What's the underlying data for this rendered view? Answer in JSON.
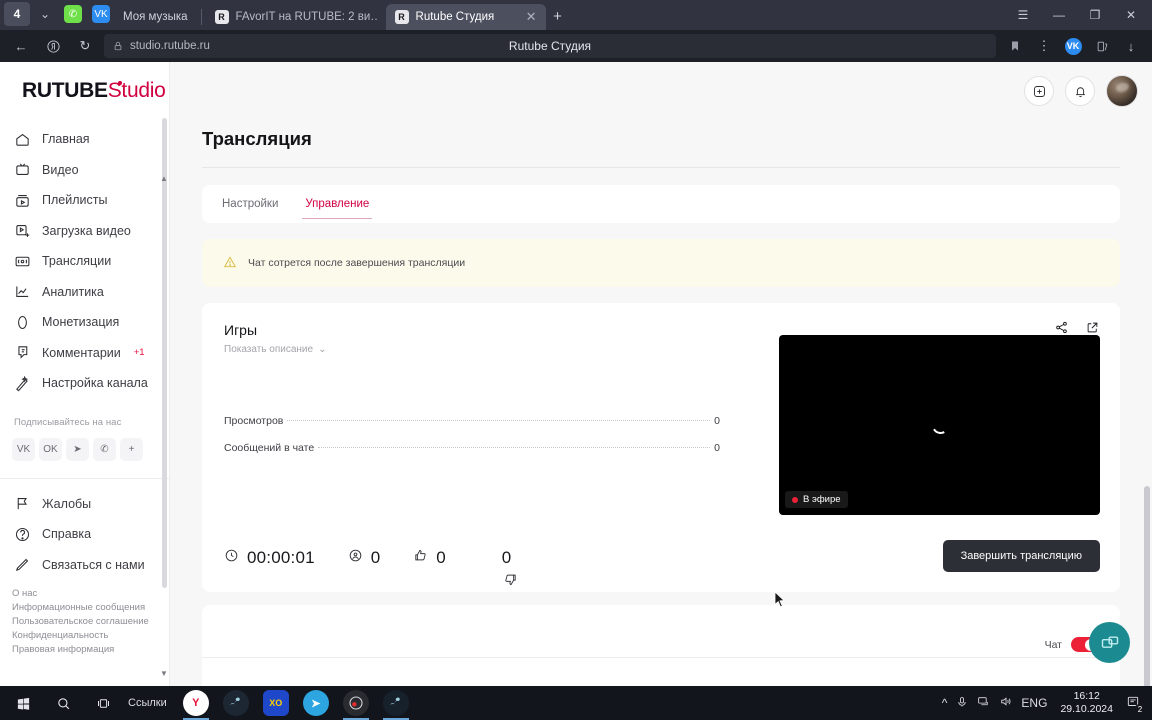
{
  "browser": {
    "profile_badge": "4",
    "extensions": [
      "whatsapp-extension",
      "vk-extension"
    ],
    "tabs": [
      {
        "title": "Моя музыка",
        "favicon": "",
        "active": false,
        "pinned": true
      },
      {
        "title": "FAvorIT на RUTUBE: 2 ви…",
        "favicon": "R",
        "active": false
      },
      {
        "title": "Rutube Студия",
        "favicon": "R",
        "active": true,
        "close": "✕"
      }
    ],
    "new_tab_label": "+",
    "window_controls": {
      "menu": "☰",
      "minimize": "—",
      "maximize": "❐",
      "close": "✕"
    },
    "nav": {
      "back": "←",
      "ya_logo": "Я",
      "reload": "↻",
      "lock": "🔒"
    },
    "url": "studio.rutube.ru",
    "page_title": "Rutube Студия",
    "right_icons": {
      "bookmark": "bookmark-icon",
      "menu": "kebab-icon",
      "vk": "VK",
      "collections": "collections-icon",
      "downloads": "↓"
    }
  },
  "app": {
    "logo": {
      "part1": "RUTUBE",
      "part2": "Studio"
    },
    "header_actions": {
      "create": "create-icon",
      "notifications": "bell-icon",
      "avatar": "avatar"
    }
  },
  "sidebar": {
    "items": [
      {
        "label": "Главная",
        "icon": "home-icon"
      },
      {
        "label": "Видео",
        "icon": "video-icon"
      },
      {
        "label": "Плейлисты",
        "icon": "playlist-icon"
      },
      {
        "label": "Загрузка видео",
        "icon": "upload-icon"
      },
      {
        "label": "Трансляции",
        "icon": "broadcast-icon",
        "active": true
      },
      {
        "label": "Аналитика",
        "icon": "analytics-icon"
      },
      {
        "label": "Монетизация",
        "icon": "monetization-icon"
      },
      {
        "label": "Комментарии",
        "icon": "comments-icon",
        "badge": "+1"
      },
      {
        "label": "Настройка канала",
        "icon": "channel-settings-icon"
      }
    ],
    "subscribe_label": "Подписывайтесь на нас",
    "socials": [
      {
        "name": "vk-icon",
        "glyph": "VK"
      },
      {
        "name": "odnoklassniki-icon",
        "glyph": "OK"
      },
      {
        "name": "telegram-icon",
        "glyph": "➤"
      },
      {
        "name": "viber-icon",
        "glyph": "✆"
      },
      {
        "name": "more-socials-icon",
        "glyph": "+"
      }
    ],
    "secondary_items": [
      {
        "label": "Жалобы",
        "icon": "flag-icon"
      },
      {
        "label": "Справка",
        "icon": "help-icon"
      },
      {
        "label": "Связаться с нами",
        "icon": "contact-icon"
      }
    ],
    "footer_links": [
      "О нас",
      "Информационные сообщения",
      "Пользовательское соглашение",
      "Конфиденциальность",
      "Правовая информация"
    ]
  },
  "main": {
    "page_title": "Трансляция",
    "tabs": [
      {
        "label": "Настройки",
        "active": false
      },
      {
        "label": "Управление",
        "active": true
      }
    ],
    "alert": {
      "icon": "warning-icon",
      "text": "Чат сотрется после завершения трансляции"
    },
    "stream_card": {
      "title": "Игры",
      "show_description": "Показать описание",
      "chevron": "⌄",
      "share_icon": "share-icon",
      "open_icon": "external-link-icon",
      "stats": [
        {
          "label": "Просмотров",
          "value": "0"
        },
        {
          "label": "Сообщений в чате",
          "value": "0"
        }
      ],
      "metrics": [
        {
          "icon": "clock-icon",
          "value": "00:00:01",
          "name": "stream-duration"
        },
        {
          "icon": "viewers-icon",
          "value": "0",
          "name": "viewers-count"
        },
        {
          "icon": "like-icon",
          "value": "0",
          "name": "likes-count"
        },
        {
          "icon": "dislike-icon",
          "value": "0",
          "name": "dislikes-count"
        }
      ],
      "preview": {
        "live_badge": "В эфире",
        "loading": true
      },
      "end_button": "Завершить трансляцию"
    },
    "chat_card": {
      "label": "Чат",
      "toggle_on": true,
      "fab_icon": "chat-popout-icon"
    }
  },
  "taskbar": {
    "start": "start-icon",
    "search": "search-icon",
    "taskview": "task-view-icon",
    "links_label": "Ссылки",
    "apps": [
      {
        "name": "yandex-browser",
        "glyph": "Y"
      },
      {
        "name": "steam",
        "glyph": "≋"
      },
      {
        "name": "xo-app",
        "glyph": "XO"
      },
      {
        "name": "telegram",
        "glyph": "➤"
      },
      {
        "name": "obs-studio",
        "glyph": "◉"
      },
      {
        "name": "steam-2",
        "glyph": "≋"
      }
    ],
    "tray": {
      "chevron": "^",
      "mic": "mic-icon",
      "network": "network-icon",
      "volume": "volume-icon",
      "lang": "ENG"
    },
    "time": "16:12",
    "date": "29.10.2024",
    "notification_count": "2"
  },
  "colors": {
    "accent": "#d1003f",
    "alert_bg": "#fcfaea",
    "live_red": "#ec2138",
    "fab_teal": "#1c8a91",
    "dark_btn": "#2d2f36"
  }
}
